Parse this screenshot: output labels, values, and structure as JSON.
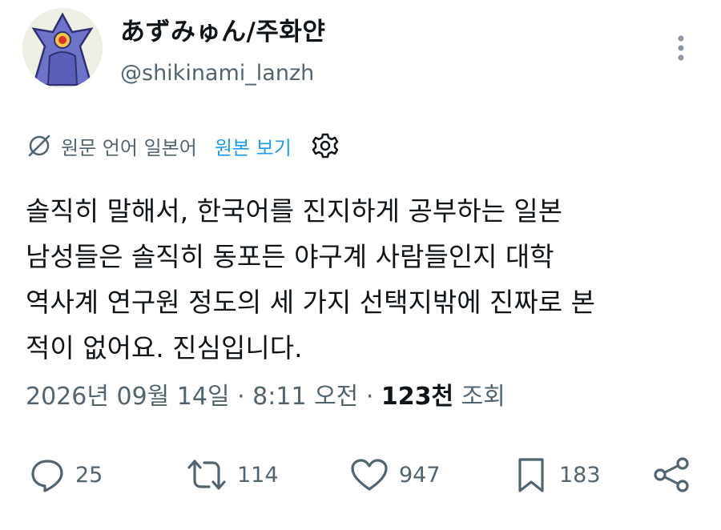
{
  "author": {
    "display_name": "あずみゅん/주화얀",
    "handle": "@shikinami_lanzh"
  },
  "icons": {
    "avatar": "avatar-image",
    "more": "more-vertical-icon",
    "translate": "translate-slash-icon",
    "settings": "gear-icon",
    "reply": "reply-icon",
    "retweet": "retweet-icon",
    "like": "heart-icon",
    "bookmark": "bookmark-icon",
    "share": "share-icon"
  },
  "translation": {
    "label": "원문 언어 일본어",
    "show_original": "원본 보기"
  },
  "tweet": {
    "lines": [
      "솔직히 말해서, 한국어를 진지하게 공부하는 일본",
      "남성들은 솔직히 동포든 야구계 사람들인지 대학",
      "역사계 연구원 정도의 세 가지 선택지밖에 진짜로 본",
      "적이 없어요. 진심입니다."
    ]
  },
  "meta": {
    "datetime": "2026년 09월 14일 · 8:11 오전 · ",
    "views_count": "123천",
    "views_label": " 조회"
  },
  "actions": {
    "replies": "25",
    "retweets": "114",
    "likes": "947",
    "bookmarks": "183"
  },
  "colors": {
    "text": "#0f1419",
    "secondary": "#536471",
    "link": "#1d9bf0"
  }
}
